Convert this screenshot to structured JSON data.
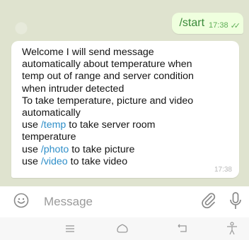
{
  "outgoing": {
    "text": "/start",
    "time": "17:38"
  },
  "incoming": {
    "lines": [
      [
        {
          "t": "Welcome I will send message",
          "c": false
        }
      ],
      [
        {
          "t": "automatically about temperature when",
          "c": false
        }
      ],
      [
        {
          "t": "temp out of range and server condition",
          "c": false
        }
      ],
      [
        {
          "t": "when intruder detected",
          "c": false
        }
      ],
      [
        {
          "t": "To take temperature,  picture and  video",
          "c": false
        }
      ],
      [
        {
          "t": "automatically",
          "c": false
        }
      ],
      [
        {
          "t": "use ",
          "c": false
        },
        {
          "t": "/temp",
          "c": true
        },
        {
          "t": " to take server room",
          "c": false
        }
      ],
      [
        {
          "t": "temperature",
          "c": false
        }
      ],
      [
        {
          "t": "use ",
          "c": false
        },
        {
          "t": "/photo",
          "c": true
        },
        {
          "t": " to take picture",
          "c": false
        }
      ],
      [
        {
          "t": "use ",
          "c": false
        },
        {
          "t": "/video",
          "c": true
        },
        {
          "t": " to take video",
          "c": false
        }
      ]
    ],
    "time": "17:38"
  },
  "input": {
    "placeholder": "Message"
  },
  "icons": {
    "emoji": "smiley-icon",
    "attach": "paperclip-icon",
    "mic": "microphone-icon",
    "menu": "menu-lines-icon",
    "home": "home-icon",
    "back": "back-icon",
    "accessibility": "accessibility-icon"
  },
  "colors": {
    "outgoing_bubble": "#efffde",
    "command_link": "#2f8fc9",
    "chat_background": "#dfe3cf"
  }
}
